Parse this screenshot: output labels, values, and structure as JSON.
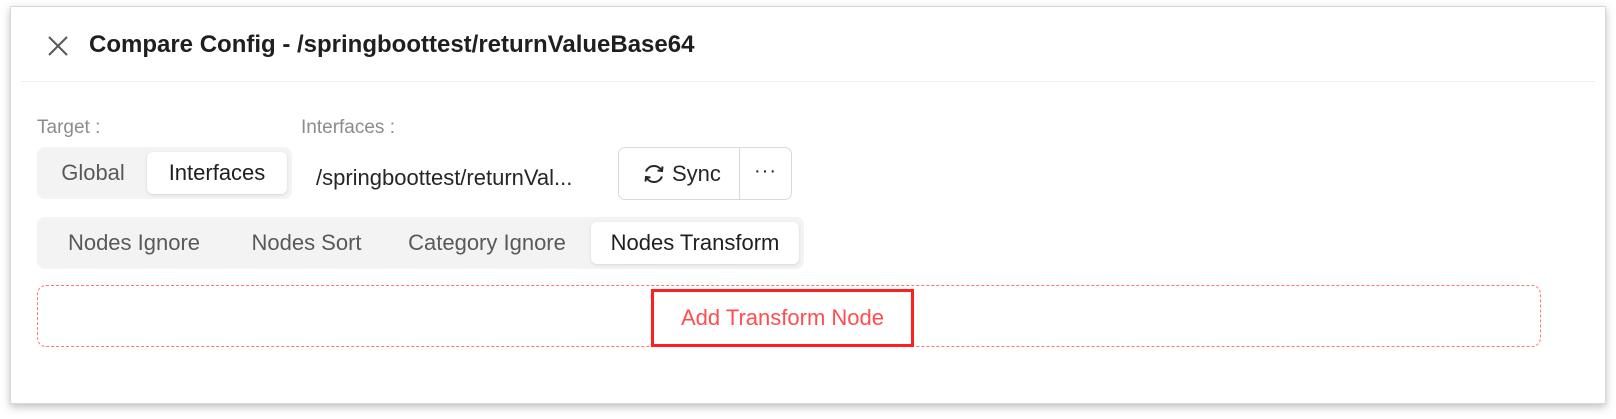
{
  "drawer": {
    "title": "Compare Config - /springboottest/returnValueBase64",
    "close_icon": "close-icon"
  },
  "target": {
    "label": "Target :",
    "options": [
      {
        "label": "Global",
        "active": false
      },
      {
        "label": "Interfaces",
        "active": true
      }
    ]
  },
  "interfaces": {
    "label": "Interfaces :",
    "selected_value": "/springboottest/returnVal..."
  },
  "actions": {
    "sync_label": "Sync",
    "sync_icon": "sync-icon",
    "more_label": "···",
    "more_icon": "ellipsis-icon"
  },
  "config_tabs": [
    {
      "label": "Nodes Ignore",
      "active": false
    },
    {
      "label": "Nodes Sort",
      "active": false
    },
    {
      "label": "Category Ignore",
      "active": false
    },
    {
      "label": "Nodes Transform",
      "active": true
    }
  ],
  "transform": {
    "add_label": "Add Transform Node"
  },
  "colors": {
    "accent_red": "#ff4d4f",
    "highlight_border": "#ff1f1f",
    "segment_bg": "#f3f3f3"
  }
}
